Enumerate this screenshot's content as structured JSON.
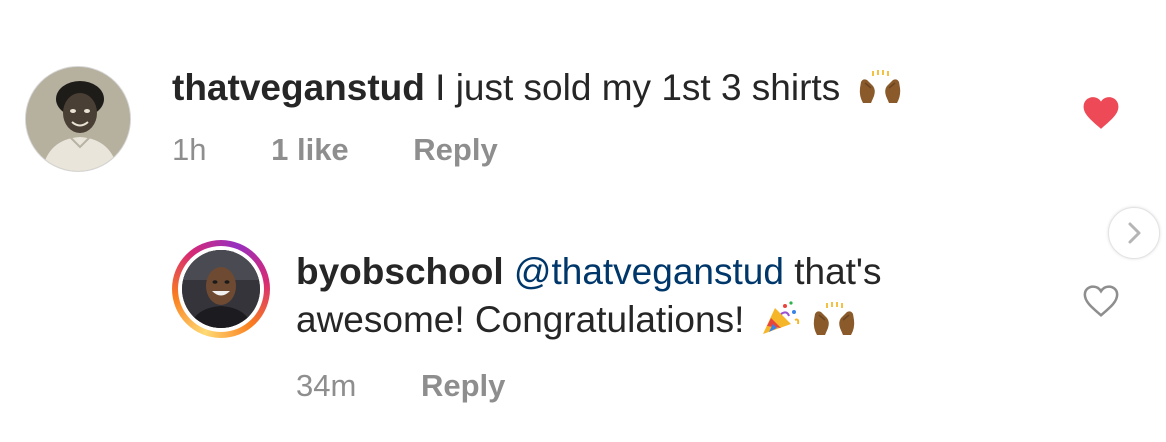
{
  "comments": [
    {
      "username": "thatveganstud",
      "text": "I just sold my 1st 3 shirts",
      "emoji": "raising-hands-icon",
      "time": "1h",
      "likes": "1 like",
      "reply_label": "Reply",
      "liked": true
    },
    {
      "username": "byobschool",
      "mention": "@thatveganstud",
      "text_line1": "that's",
      "text_line2": "awesome! Congratulations!",
      "emoji": [
        "party-popper-icon",
        "raising-hands-icon"
      ],
      "time": "34m",
      "reply_label": "Reply",
      "liked": false
    }
  ],
  "colors": {
    "heart_liked": "#ed4956",
    "mention": "#00376b",
    "meta": "#8e8e8e",
    "text": "#262626"
  }
}
